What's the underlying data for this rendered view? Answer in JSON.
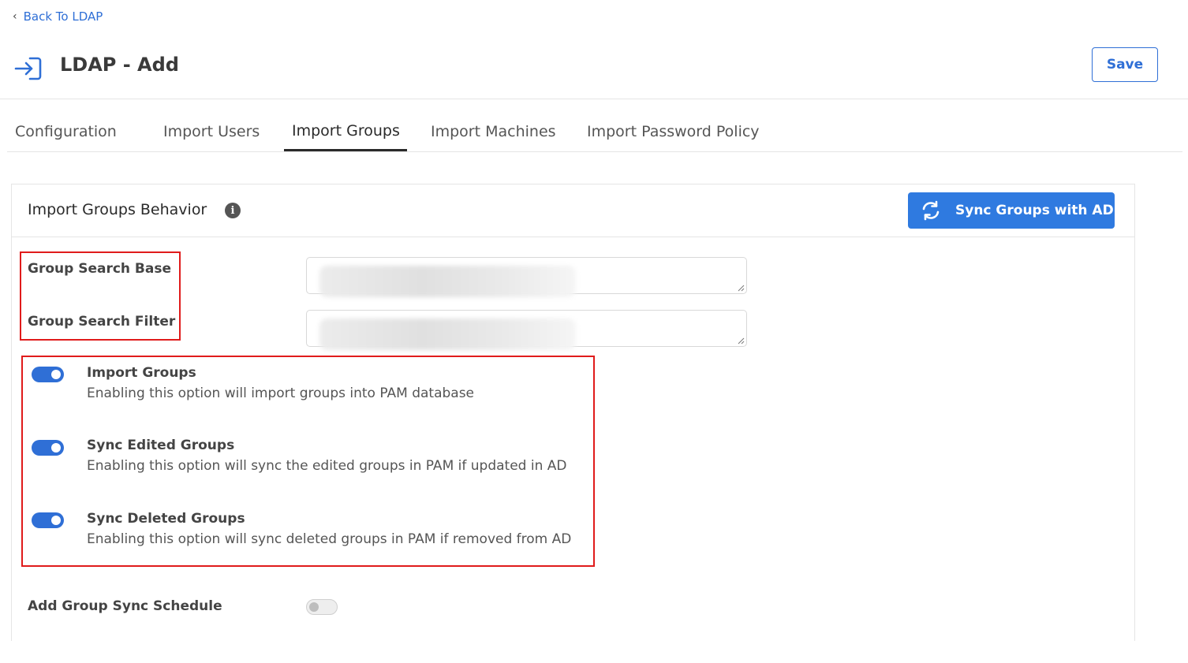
{
  "back_link": {
    "label": "Back To LDAP"
  },
  "header": {
    "title": "LDAP - Add",
    "save_label": "Save"
  },
  "tabs": [
    {
      "label": "Configuration",
      "active": false
    },
    {
      "label": "Import Users",
      "active": false
    },
    {
      "label": "Import Groups",
      "active": true
    },
    {
      "label": "Import Machines",
      "active": false
    },
    {
      "label": "Import Password Policy",
      "active": false
    }
  ],
  "section": {
    "title": "Import Groups Behavior",
    "sync_button_label": "Sync Groups with AD",
    "fields": [
      {
        "label": "Group Search Base",
        "value": ""
      },
      {
        "label": "Group Search Filter",
        "value": ""
      }
    ],
    "options": [
      {
        "title": "Import Groups",
        "description": "Enabling this option will import groups into PAM database",
        "enabled": true
      },
      {
        "title": "Sync Edited Groups",
        "description": "Enabling this option will sync the edited groups in PAM if updated in AD",
        "enabled": true
      },
      {
        "title": "Sync Deleted Groups",
        "description": "Enabling this option will sync deleted groups in PAM if removed from AD",
        "enabled": true
      }
    ],
    "schedule": {
      "label": "Add Group Sync Schedule",
      "enabled": false
    }
  },
  "colors": {
    "accent": "#2f6fd6",
    "sync_button": "#2f7ae0",
    "highlight": "#e01b1b"
  }
}
